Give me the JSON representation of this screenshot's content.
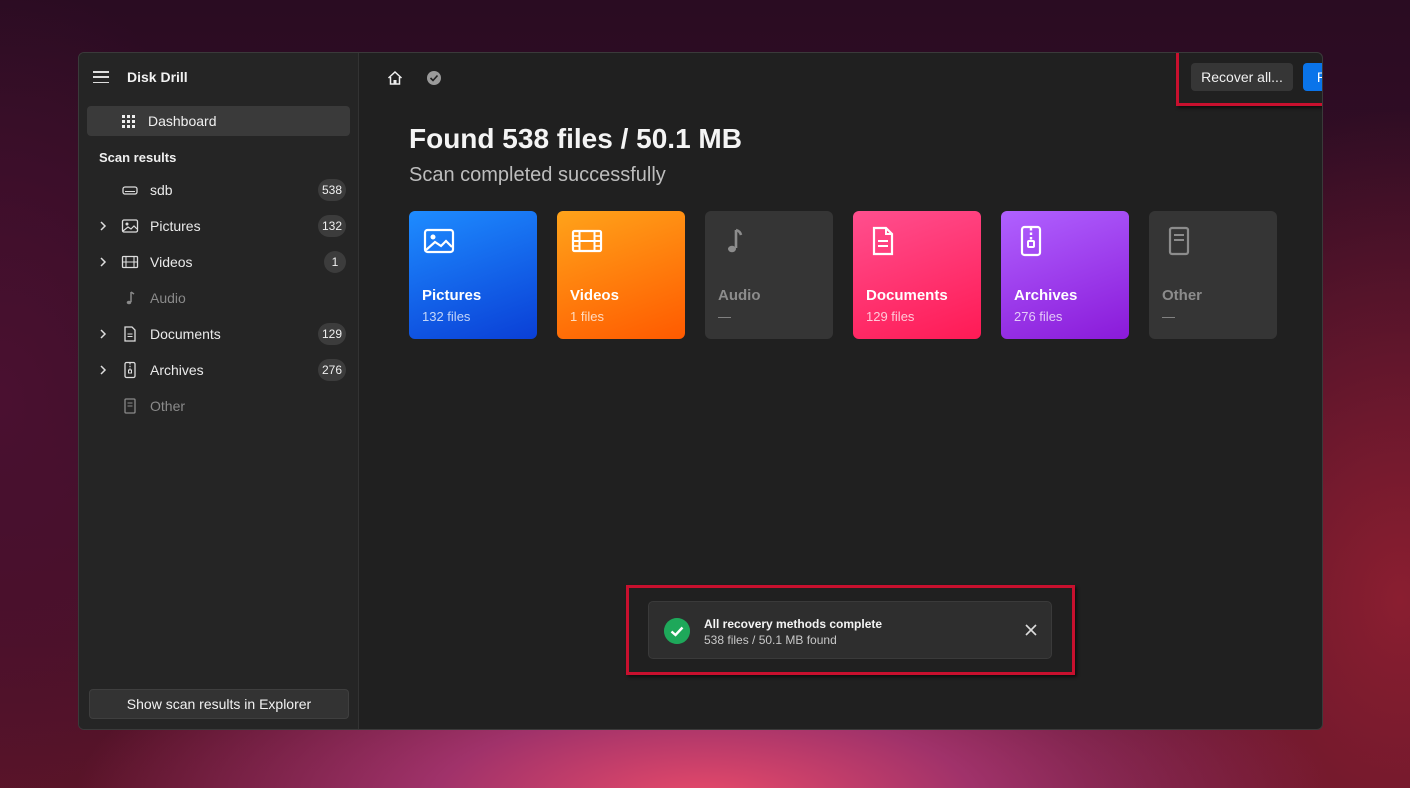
{
  "app": {
    "title": "Disk Drill"
  },
  "sidebar": {
    "dashboard_label": "Dashboard",
    "section_title": "Scan results",
    "items": [
      {
        "label": "sdb",
        "count": "538",
        "icon": "drive-icon",
        "expandable": false,
        "enabled": true
      },
      {
        "label": "Pictures",
        "count": "132",
        "icon": "picture-icon",
        "expandable": true,
        "enabled": true
      },
      {
        "label": "Videos",
        "count": "1",
        "icon": "film-icon",
        "expandable": true,
        "enabled": true
      },
      {
        "label": "Audio",
        "count": "",
        "icon": "music-note-icon",
        "expandable": false,
        "enabled": false
      },
      {
        "label": "Documents",
        "count": "129",
        "icon": "document-icon",
        "expandable": true,
        "enabled": true
      },
      {
        "label": "Archives",
        "count": "276",
        "icon": "archive-icon",
        "expandable": true,
        "enabled": true
      },
      {
        "label": "Other",
        "count": "",
        "icon": "file-icon",
        "expandable": false,
        "enabled": false
      }
    ],
    "explorer_button": "Show scan results in Explorer"
  },
  "toolbar": {
    "recover_all_label": "Recover all...",
    "review_label": "Review found items",
    "home_icon": "home-icon",
    "status_icon": "check-circle-icon"
  },
  "main": {
    "title": "Found 538 files / 50.1 MB",
    "subtitle": "Scan completed successfully",
    "cards": [
      {
        "name": "Pictures",
        "sub": "132 files",
        "icon": "picture-icon"
      },
      {
        "name": "Videos",
        "sub": "1 files",
        "icon": "film-icon"
      },
      {
        "name": "Audio",
        "sub": "—",
        "icon": "music-note-icon"
      },
      {
        "name": "Documents",
        "sub": "129 files",
        "icon": "document-icon"
      },
      {
        "name": "Archives",
        "sub": "276 files",
        "icon": "archive-icon"
      },
      {
        "name": "Other",
        "sub": "—",
        "icon": "file-icon"
      }
    ]
  },
  "toast": {
    "title": "All recovery methods complete",
    "subtitle": "538 files / 50.1 MB found"
  },
  "colors": {
    "accent": "#0a74ea",
    "highlight_box": "#c8102e",
    "success": "#1ea85a"
  }
}
